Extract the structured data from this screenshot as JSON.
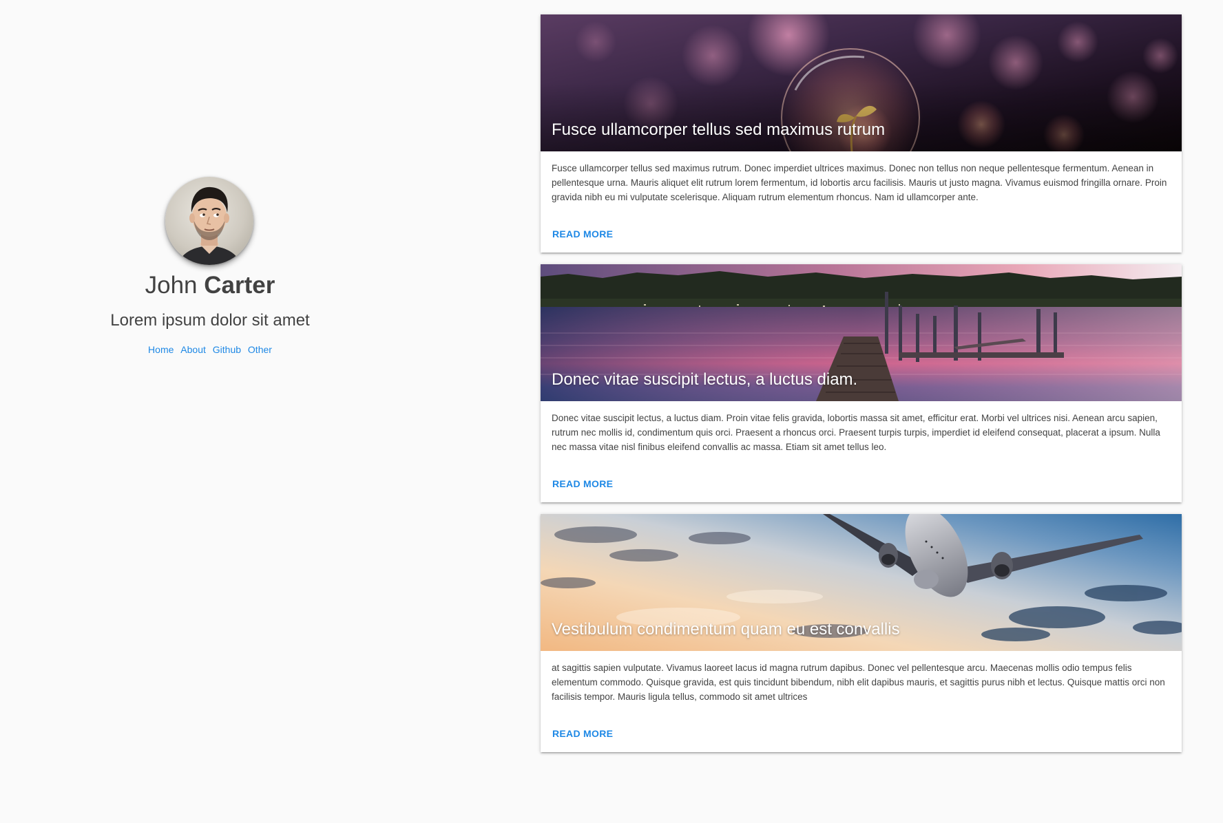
{
  "profile": {
    "first_name": "John ",
    "last_name": "Carter",
    "tagline": "Lorem ipsum dolor sit amet",
    "nav": [
      "Home",
      "About",
      "Github",
      "Other"
    ]
  },
  "cards": [
    {
      "title": "Fusce ullamcorper tellus sed maximus rutrum",
      "text": "Fusce ullamcorper tellus sed maximus rutrum. Donec imperdiet ultrices maximus. Donec non tellus non neque pellentesque fermentum. Aenean in pellentesque urna. Mauris aliquet elit rutrum lorem fermentum, id lobortis arcu facilisis. Mauris ut justo magna. Vivamus euismod fringilla ornare. Proin gravida nibh eu mi vulputate scelerisque. Aliquam rutrum elementum rhoncus. Nam id ullamcorper ante.",
      "action": "READ MORE"
    },
    {
      "title": "Donec vitae suscipit lectus, a luctus diam.",
      "text": "Donec vitae suscipit lectus, a luctus diam. Proin vitae felis gravida, lobortis massa sit amet, efficitur erat. Morbi vel ultrices nisi. Aenean arcu sapien, rutrum nec mollis id, condimentum quis orci. Praesent a rhoncus orci. Praesent turpis turpis, imperdiet id eleifend consequat, placerat a ipsum. Nulla nec massa vitae nisl finibus eleifend convallis ac massa. Etiam sit amet tellus leo.",
      "action": "READ MORE"
    },
    {
      "title": "Vestibulum condimentum quam eu est convallis",
      "text": "at sagittis sapien vulputate. Vivamus laoreet lacus id magna rutrum dapibus. Donec vel pellentesque arcu. Maecenas mollis odio tempus felis elementum commodo. Quisque gravida, est quis tincidunt bibendum, nibh elit dapibus mauris, et sagittis purus nibh et lectus. Quisque mattis orci non facilisis tempor. Mauris ligula tellus, commodo sit amet ultrices",
      "action": "READ MORE"
    }
  ],
  "colors": {
    "background": "#fafafa",
    "link": "#1e88e5",
    "text": "#424242"
  }
}
